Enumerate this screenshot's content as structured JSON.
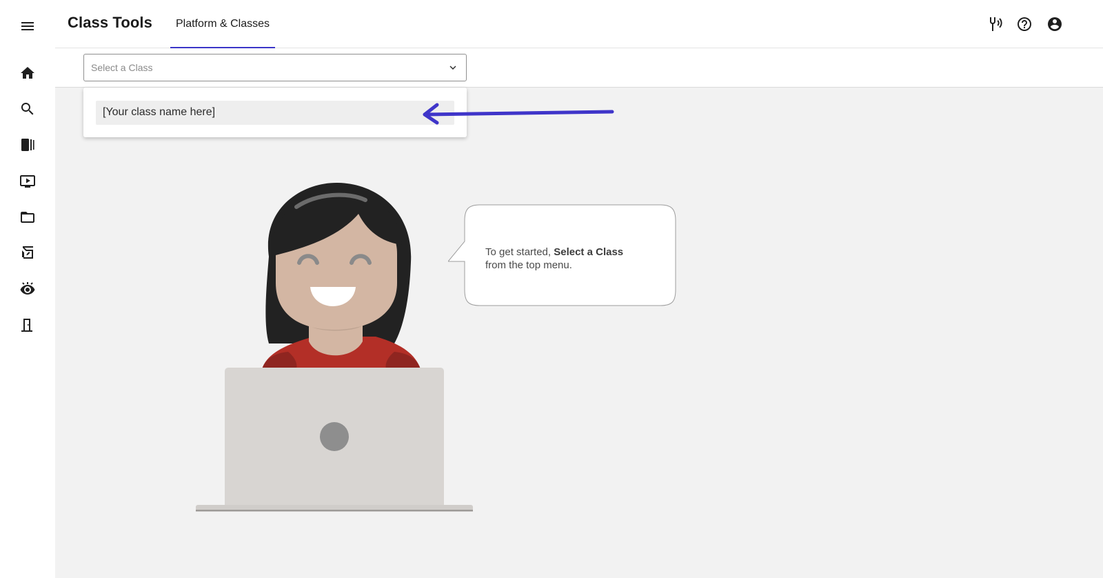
{
  "header": {
    "app_title": "Class Tools",
    "tab_label": "Platform & Classes"
  },
  "class_select": {
    "placeholder": "Select a Class",
    "options": [
      "[Your class name here]"
    ]
  },
  "message": {
    "prefix": "To get started, ",
    "emphasis": "Select a Class",
    "suffix": "from the top menu."
  },
  "icons": {
    "menu": "hamburger-menu-icon",
    "rail": [
      "home-icon",
      "search-icon",
      "library-icon",
      "video-icon",
      "folder-icon",
      "assignment-icon",
      "visibility-icon",
      "exit-icon"
    ],
    "top": [
      "accessibility-audio-icon",
      "help-icon",
      "account-icon"
    ]
  },
  "colors": {
    "accent": "#3b35c8",
    "arrow": "#3f35c9",
    "content_background": "#f2f2f2",
    "shirt": "#b32f27",
    "laptop": "#d8d5d2"
  }
}
